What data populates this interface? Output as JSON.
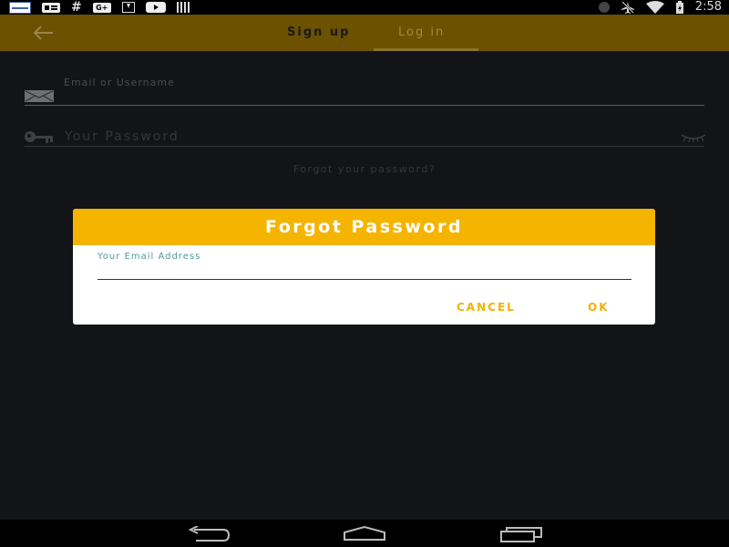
{
  "status_bar": {
    "time": "2:58",
    "left_icons": [
      "news-icon",
      "card-icon",
      "hashtag-icon",
      "google-plus-icon",
      "download-icon",
      "youtube-icon",
      "barcode-icon"
    ],
    "right_icons": [
      "bluetooth-icon",
      "airplane-mode-icon",
      "wifi-icon",
      "battery-charging-icon"
    ],
    "gplus_text": "G+"
  },
  "app_bar": {
    "tabs": [
      {
        "label": "Sign up",
        "selected": false
      },
      {
        "label": "Log in",
        "selected": true
      }
    ]
  },
  "form": {
    "email_label": "Email or Username",
    "password_placeholder": "Your Password",
    "forgot_link": "Forgot your password?"
  },
  "dialog": {
    "title": "Forgot Password",
    "email_label": "Your Email Address",
    "email_value": "",
    "cancel_label": "CANCEL",
    "ok_label": "OK"
  },
  "colors": {
    "accent": "#f5b400",
    "app_bar_dimmed": "#6b5100",
    "background": "#131418",
    "label_teal": "#4f9a9a"
  }
}
